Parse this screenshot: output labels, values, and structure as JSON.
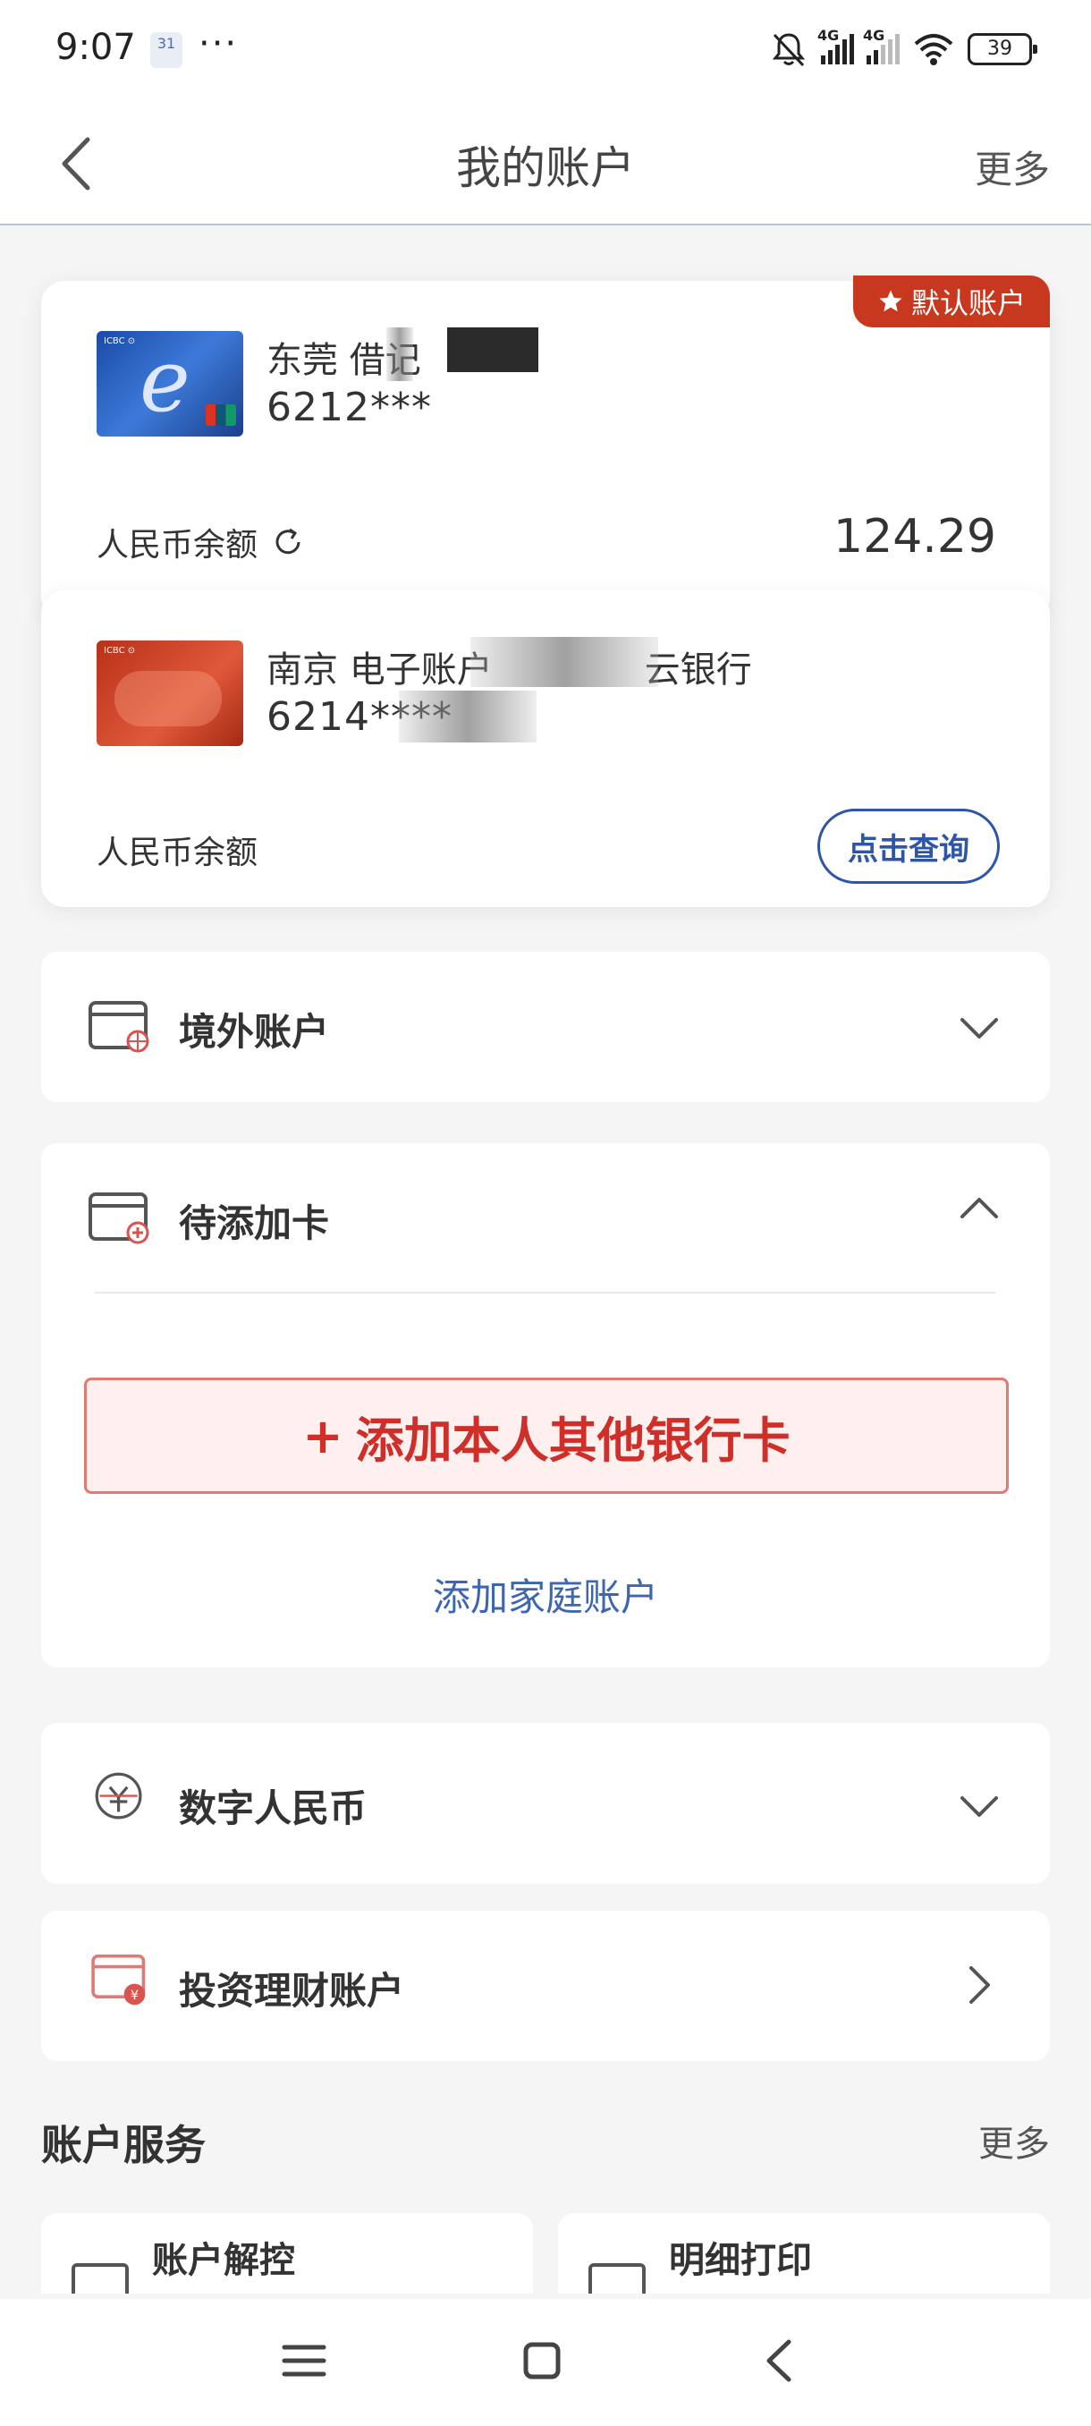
{
  "status_bar": {
    "time": "9:07",
    "calendar_day": "31",
    "more": "···",
    "network1": "4G",
    "network2": "4G",
    "battery": "39"
  },
  "header": {
    "title": "我的账户",
    "more": "更多"
  },
  "cards": [
    {
      "name": "东莞 借记",
      "number": "6212***",
      "balance_label": "人民币余额",
      "balance": "124.29",
      "badge": "默认账户"
    },
    {
      "name_prefix": "南京 电子账户",
      "name_suffix": "云银行",
      "number": "6214****",
      "balance_label": "人民币余额",
      "query_label": "点击查询"
    }
  ],
  "sections": {
    "overseas": "境外账户",
    "pending": "待添加卡",
    "add_card": "添加本人其他银行卡",
    "add_family": "添加家庭账户",
    "digital_rmb": "数字人民币",
    "invest": "投资理财账户"
  },
  "services": {
    "title": "账户服务",
    "more": "更多",
    "items": [
      "账户解控",
      "明细打印"
    ]
  },
  "colors": {
    "accent_red": "#cf2f28",
    "link_blue": "#3d66b0",
    "badge_red": "#c8381e"
  }
}
